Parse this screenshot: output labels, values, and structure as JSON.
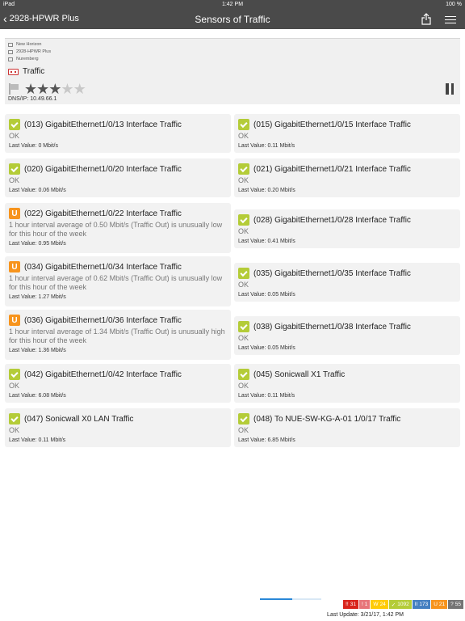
{
  "status_bar": {
    "device": "iPad",
    "time": "1:42 PM",
    "battery": "100 %"
  },
  "nav": {
    "back_label": "2928-HPWR Plus",
    "title": "Sensors of Traffic"
  },
  "device_info": {
    "breadcrumbs": [
      "New Horizon",
      "2928-HPWR Plus",
      "Nuremberg"
    ],
    "name": "Traffic",
    "priority": 3,
    "priority_max": 5,
    "dns_label": "DNS/IP:",
    "dns_value": "10.49.66.1"
  },
  "last_value_label": "Last Value:",
  "sensors": [
    {
      "status": "ok",
      "badge": "",
      "name": "(013) GigabitEthernet1/0/13 Interface Traffic",
      "message": "OK",
      "last_value": "0 Mbit/s"
    },
    {
      "status": "ok",
      "badge": "",
      "name": "(015) GigabitEthernet1/0/15 Interface Traffic",
      "message": "OK",
      "last_value": "0.11 Mbit/s"
    },
    {
      "status": "ok",
      "badge": "",
      "name": "(020) GigabitEthernet1/0/20 Interface Traffic",
      "message": "OK",
      "last_value": "0.06 Mbit/s"
    },
    {
      "status": "ok",
      "badge": "",
      "name": "(021) GigabitEthernet1/0/21 Interface Traffic",
      "message": "OK",
      "last_value": "0.20 Mbit/s"
    },
    {
      "status": "unusual",
      "badge": "U",
      "name": "(022) GigabitEthernet1/0/22 Interface Traffic",
      "message": "1 hour interval average of 0.50 Mbit/s (Traffic Out) is unusually low for this hour of the week",
      "last_value": "0.95 Mbit/s"
    },
    {
      "status": "ok",
      "badge": "",
      "name": "(028) GigabitEthernet1/0/28 Interface Traffic",
      "message": "OK",
      "last_value": "0.41 Mbit/s"
    },
    {
      "status": "unusual",
      "badge": "U",
      "name": "(034) GigabitEthernet1/0/34 Interface Traffic",
      "message": "1 hour interval average of 0.62 Mbit/s (Traffic Out) is unusually low for this hour of the week",
      "last_value": "1.27 Mbit/s"
    },
    {
      "status": "ok",
      "badge": "",
      "name": "(035) GigabitEthernet1/0/35 Interface Traffic",
      "message": "OK",
      "last_value": "0.05 Mbit/s"
    },
    {
      "status": "unusual",
      "badge": "U",
      "name": "(036) GigabitEthernet1/0/36 Interface Traffic",
      "message": "1 hour interval average of 1.34 Mbit/s (Traffic Out) is unusually high for this hour of the week",
      "last_value": "1.36 Mbit/s"
    },
    {
      "status": "ok",
      "badge": "",
      "name": "(038) GigabitEthernet1/0/38 Interface Traffic",
      "message": "OK",
      "last_value": "0.05 Mbit/s"
    },
    {
      "status": "ok",
      "badge": "",
      "name": "(042) GigabitEthernet1/0/42 Interface Traffic",
      "message": "OK",
      "last_value": "6.08 Mbit/s"
    },
    {
      "status": "ok",
      "badge": "",
      "name": "(045) Sonicwall X1 Traffic",
      "message": "OK",
      "last_value": "0.11 Mbit/s"
    },
    {
      "status": "ok",
      "badge": "",
      "name": "(047) Sonicwall X0 LAN Traffic",
      "message": "OK",
      "last_value": "0.11 Mbit/s"
    },
    {
      "status": "ok",
      "badge": "",
      "name": "(048) To NUE-SW-KG-A-01 1/0/17 Traffic",
      "message": "OK",
      "last_value": "6.85 Mbit/s"
    }
  ],
  "refresh_progress": 0.52,
  "status_badges": [
    {
      "icon": "!!",
      "count": "31",
      "color": "#d9251d"
    },
    {
      "icon": "!",
      "count": "1",
      "color": "#e77579"
    },
    {
      "icon": "W",
      "count": "24",
      "color": "#ffcb05"
    },
    {
      "icon": "✓",
      "count": "1092",
      "color": "#b4cc38"
    },
    {
      "icon": "II",
      "count": "173",
      "color": "#447fc1"
    },
    {
      "icon": "U",
      "count": "21",
      "color": "#f7941d"
    },
    {
      "icon": "?",
      "count": "55",
      "color": "#757575"
    }
  ],
  "last_update": "Last Update: 3/21/17, 1:42 PM"
}
